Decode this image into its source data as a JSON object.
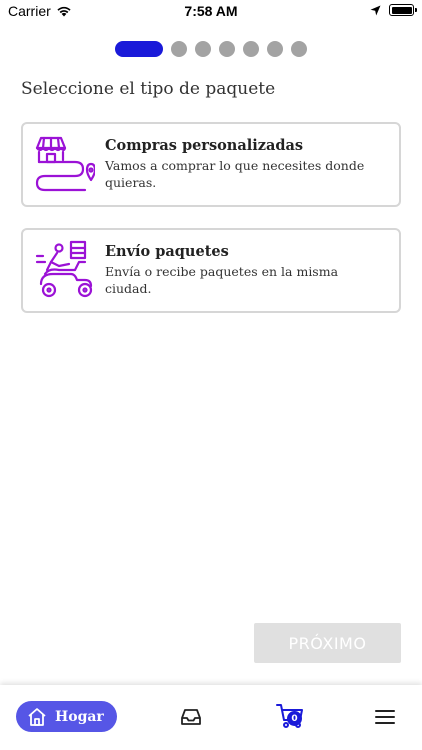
{
  "status_bar": {
    "carrier": "Carrier",
    "time": "7:58 AM"
  },
  "stepper": {
    "total_steps": 7,
    "current_step": 1
  },
  "page": {
    "title": "Seleccione el tipo de paquete"
  },
  "options": [
    {
      "title": "Compras personalizadas",
      "description": "Vamos a comprar lo que necesites donde quieras.",
      "icon": "shop-route-icon"
    },
    {
      "title": "Envío paquetes",
      "description": "Envía o recibe paquetes en la misma ciudad.",
      "icon": "delivery-scooter-icon"
    }
  ],
  "actions": {
    "next_label": "PRÓXIMO"
  },
  "bottom_nav": {
    "home_label": "Hogar",
    "cart_count": "0"
  },
  "colors": {
    "accent": "#1a1ad9",
    "icon_purple": "#9b12d6",
    "nav_home_bg": "#5656e6",
    "disabled_button": "#e0e0e0"
  }
}
